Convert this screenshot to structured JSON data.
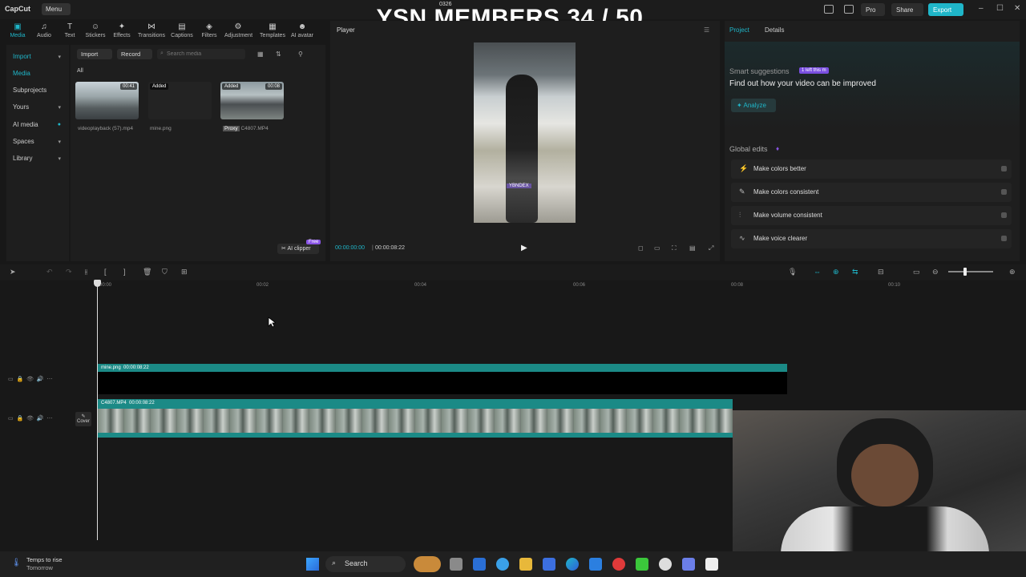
{
  "topbar": {
    "app_name": "CapCut",
    "menu_label": "Menu",
    "overlay_title": "YSN MEMBERS 34 / 50",
    "overlay_small": "0326",
    "pro_label": "Pro",
    "share_label": "Share",
    "export_label": "Export"
  },
  "tools": [
    {
      "label": "Media",
      "icon": "media-icon"
    },
    {
      "label": "Audio",
      "icon": "audio-icon"
    },
    {
      "label": "Text",
      "icon": "text-icon"
    },
    {
      "label": "Stickers",
      "icon": "stickers-icon"
    },
    {
      "label": "Effects",
      "icon": "effects-icon"
    },
    {
      "label": "Transitions",
      "icon": "transitions-icon"
    },
    {
      "label": "Captions",
      "icon": "captions-icon"
    },
    {
      "label": "Filters",
      "icon": "filters-icon"
    },
    {
      "label": "Adjustment",
      "icon": "adjustment-icon"
    },
    {
      "label": "Templates",
      "icon": "templates-icon"
    },
    {
      "label": "AI avatar",
      "icon": "ai-avatar-icon"
    }
  ],
  "leftnav": {
    "import": "Import",
    "media": "Media",
    "subprojects": "Subprojects",
    "yours": "Yours",
    "ai_media": "AI media",
    "spaces": "Spaces",
    "library": "Library"
  },
  "media": {
    "import_btn": "Import",
    "record_btn": "Record",
    "search_placeholder": "Search media",
    "filter_all": "All",
    "items": [
      {
        "name": "videoplayback (57).mp4",
        "duration": "00:41"
      },
      {
        "name": "mine.png",
        "added": "Added"
      },
      {
        "name": "C4807.MP4",
        "added": "Added",
        "duration": "00:08",
        "proxy": "Proxy"
      }
    ],
    "ai_clipper": "AI clipper",
    "ai_clipper_badge": "Free"
  },
  "player": {
    "title": "Player",
    "current_time": "00:00:00:00",
    "total_time": "00:00:08:22",
    "video_caption": "YBNDEX"
  },
  "props": {
    "tab_project": "Project",
    "tab_details": "Details",
    "smart_title": "Smart suggestions",
    "smart_badge": "1 left this m",
    "smart_text": "Find out how your video can be improved",
    "analyze_btn": "Analyze",
    "global_title": "Global edits",
    "global_items": [
      "Make colors better",
      "Make colors consistent",
      "Make volume consistent",
      "Make voice clearer"
    ]
  },
  "timeline": {
    "ruler": [
      "00:00",
      "00:02",
      "00:04",
      "00:06",
      "00:08",
      "00:10"
    ],
    "track1_label": "mine.png",
    "track1_duration": "00:00:08:22",
    "track2_label": "C4807.MP4",
    "track2_duration": "00:00:08:22",
    "cover_label": "Cover"
  },
  "taskbar": {
    "weather_line1": "Temps to rise",
    "weather_line2": "Tomorrow",
    "search_label": "Search"
  },
  "colors": {
    "accent": "#1fb6c9",
    "track": "#1b8a86"
  }
}
